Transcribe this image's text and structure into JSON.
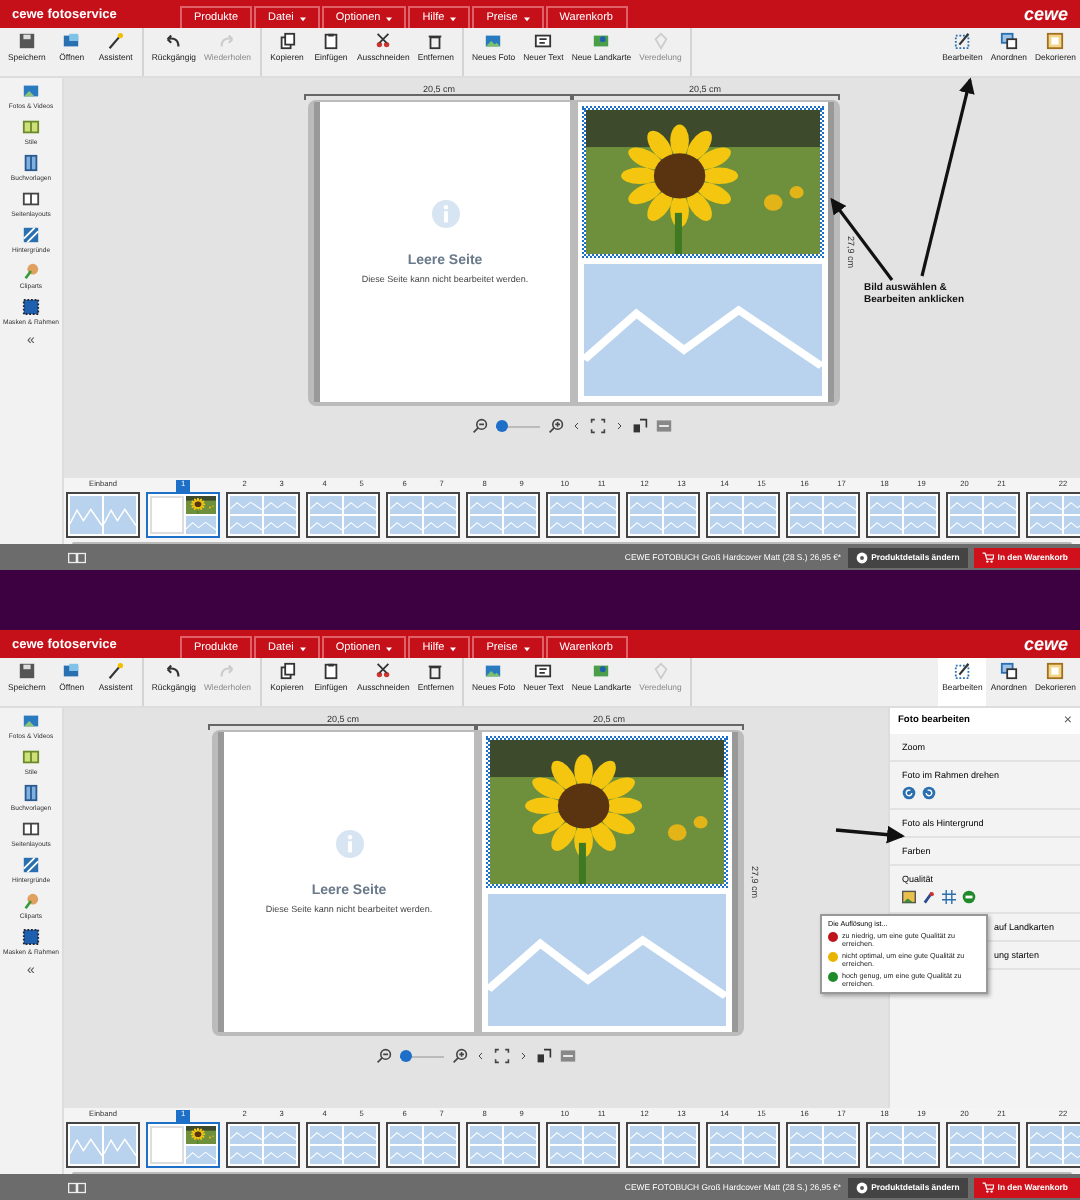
{
  "screens": [
    {
      "header": {
        "brand": "cewe fotoservice",
        "logo": "cewe",
        "menus": [
          {
            "label": "Produkte",
            "has_menu": false
          },
          {
            "label": "Datei",
            "has_menu": true
          },
          {
            "label": "Optionen",
            "has_menu": true
          },
          {
            "label": "Hilfe",
            "has_menu": true
          },
          {
            "label": "Preise",
            "has_menu": true
          },
          {
            "label": "Warenkorb",
            "has_menu": false
          }
        ]
      },
      "toolbar": {
        "groups": [
          [
            {
              "label": "Speichern",
              "disabled": false
            },
            {
              "label": "Öffnen",
              "disabled": false
            },
            {
              "label": "Assistent",
              "disabled": false
            }
          ],
          [
            {
              "label": "Rückgängig",
              "disabled": false
            },
            {
              "label": "Wiederholen",
              "disabled": true
            }
          ],
          [
            {
              "label": "Kopieren",
              "disabled": false
            },
            {
              "label": "Einfügen",
              "disabled": false
            },
            {
              "label": "Ausschneiden",
              "disabled": false
            },
            {
              "label": "Entfernen",
              "disabled": false
            }
          ],
          [
            {
              "label": "Neues Foto",
              "disabled": false
            },
            {
              "label": "Neuer Text",
              "disabled": false
            },
            {
              "label": "Neue Landkarte",
              "disabled": false
            },
            {
              "label": "Veredelung",
              "disabled": true
            }
          ]
        ],
        "right": [
          {
            "label": "Bearbeiten",
            "selected": false
          },
          {
            "label": "Anordnen",
            "selected": false
          },
          {
            "label": "Dekorieren",
            "selected": false
          }
        ]
      },
      "sidebar": {
        "items": [
          "Fotos & Videos",
          "Stile",
          "Buchvorlagen",
          "Seitenlayouts",
          "Hintergründe",
          "Cliparts",
          "Masken & Rahmen"
        ],
        "collapse": "«"
      },
      "spread": {
        "width_labels": [
          "20,5 cm",
          "20,5 cm"
        ],
        "height_label": "27,9 cm",
        "blank_title": "Leere Seite",
        "blank_text": "Diese Seite kann nicht bearbeitet werden.",
        "photo_selected": true
      },
      "zoom": {
        "level": 0.12
      },
      "filmstrip": [
        {
          "labels": [
            "Einband"
          ],
          "selected": false,
          "kind": "cover"
        },
        {
          "labels": [
            "1"
          ],
          "selected": true,
          "kind": "first"
        },
        {
          "labels": [
            "2",
            "3"
          ],
          "selected": false,
          "kind": "layout"
        },
        {
          "labels": [
            "4",
            "5"
          ],
          "selected": false,
          "kind": "layout"
        },
        {
          "labels": [
            "6",
            "7"
          ],
          "selected": false,
          "kind": "layout"
        },
        {
          "labels": [
            "8",
            "9"
          ],
          "selected": false,
          "kind": "layout"
        },
        {
          "labels": [
            "10",
            "11"
          ],
          "selected": false,
          "kind": "layout"
        },
        {
          "labels": [
            "12",
            "13"
          ],
          "selected": false,
          "kind": "layout"
        },
        {
          "labels": [
            "14",
            "15"
          ],
          "selected": false,
          "kind": "layout"
        },
        {
          "labels": [
            "16",
            "17"
          ],
          "selected": false,
          "kind": "layout"
        },
        {
          "labels": [
            "18",
            "19"
          ],
          "selected": false,
          "kind": "layout"
        },
        {
          "labels": [
            "20",
            "21"
          ],
          "selected": false,
          "kind": "layout"
        },
        {
          "labels": [
            "22"
          ],
          "selected": false,
          "kind": "layout"
        }
      ],
      "status": {
        "product": "CEWE FOTOBUCH Groß Hardcover Matt (28 S.) 26,95 €*",
        "details": "Produktdetails ändern",
        "cart": "In den Warenkorb"
      },
      "callout": {
        "kind": "text-arrows",
        "text": "Bild auswählen &\nBearbeiten anklicken"
      }
    },
    {
      "header": {
        "brand": "cewe fotoservice",
        "logo": "cewe",
        "menus": [
          {
            "label": "Produkte",
            "has_menu": false
          },
          {
            "label": "Datei",
            "has_menu": true
          },
          {
            "label": "Optionen",
            "has_menu": true
          },
          {
            "label": "Hilfe",
            "has_menu": true
          },
          {
            "label": "Preise",
            "has_menu": true
          },
          {
            "label": "Warenkorb",
            "has_menu": false
          }
        ]
      },
      "toolbar": {
        "groups": [
          [
            {
              "label": "Speichern",
              "disabled": false
            },
            {
              "label": "Öffnen",
              "disabled": false
            },
            {
              "label": "Assistent",
              "disabled": false
            }
          ],
          [
            {
              "label": "Rückgängig",
              "disabled": false
            },
            {
              "label": "Wiederholen",
              "disabled": true
            }
          ],
          [
            {
              "label": "Kopieren",
              "disabled": false
            },
            {
              "label": "Einfügen",
              "disabled": false
            },
            {
              "label": "Ausschneiden",
              "disabled": false
            },
            {
              "label": "Entfernen",
              "disabled": false
            }
          ],
          [
            {
              "label": "Neues Foto",
              "disabled": false
            },
            {
              "label": "Neuer Text",
              "disabled": false
            },
            {
              "label": "Neue Landkarte",
              "disabled": false
            },
            {
              "label": "Veredelung",
              "disabled": true
            }
          ]
        ],
        "right": [
          {
            "label": "Bearbeiten",
            "selected": true
          },
          {
            "label": "Anordnen",
            "selected": false
          },
          {
            "label": "Dekorieren",
            "selected": false
          }
        ]
      },
      "sidebar": {
        "items": [
          "Fotos & Videos",
          "Stile",
          "Buchvorlagen",
          "Seitenlayouts",
          "Hintergründe",
          "Cliparts",
          "Masken & Rahmen"
        ],
        "collapse": "«"
      },
      "spread": {
        "width_labels": [
          "20,5 cm",
          "20,5 cm"
        ],
        "height_label": "27,9 cm",
        "blank_title": "Leere Seite",
        "blank_text": "Diese Seite kann nicht bearbeitet werden.",
        "photo_selected": true
      },
      "zoom": {
        "level": 0.12
      },
      "filmstrip": [
        {
          "labels": [
            "Einband"
          ],
          "selected": false,
          "kind": "cover"
        },
        {
          "labels": [
            "1"
          ],
          "selected": true,
          "kind": "first"
        },
        {
          "labels": [
            "2",
            "3"
          ],
          "selected": false,
          "kind": "layout"
        },
        {
          "labels": [
            "4",
            "5"
          ],
          "selected": false,
          "kind": "layout"
        },
        {
          "labels": [
            "6",
            "7"
          ],
          "selected": false,
          "kind": "layout"
        },
        {
          "labels": [
            "8",
            "9"
          ],
          "selected": false,
          "kind": "layout"
        },
        {
          "labels": [
            "10",
            "11"
          ],
          "selected": false,
          "kind": "layout"
        },
        {
          "labels": [
            "12",
            "13"
          ],
          "selected": false,
          "kind": "layout"
        },
        {
          "labels": [
            "14",
            "15"
          ],
          "selected": false,
          "kind": "layout"
        },
        {
          "labels": [
            "16",
            "17"
          ],
          "selected": false,
          "kind": "layout"
        },
        {
          "labels": [
            "18",
            "19"
          ],
          "selected": false,
          "kind": "layout"
        },
        {
          "labels": [
            "20",
            "21"
          ],
          "selected": false,
          "kind": "layout"
        },
        {
          "labels": [
            "22"
          ],
          "selected": false,
          "kind": "layout"
        }
      ],
      "status": {
        "product": "CEWE FOTOBUCH Groß Hardcover Matt (28 S.) 26,95 €*",
        "details": "Produktdetails ändern",
        "cart": "In den Warenkorb"
      },
      "callout": {
        "kind": "arrow"
      },
      "edit_panel": {
        "title": "Foto bearbeiten",
        "close": "×",
        "sections": [
          {
            "label": "Zoom",
            "kind": "plain"
          },
          {
            "label": "Foto im Rahmen drehen",
            "kind": "rotate"
          },
          {
            "label": "Foto als Hintergrund",
            "kind": "plain"
          },
          {
            "label": "Farben",
            "kind": "plain"
          },
          {
            "label": "Qualität",
            "kind": "quality"
          },
          {
            "label": "auf Landkarten",
            "kind": "covered"
          },
          {
            "label": "ung starten",
            "kind": "covered"
          }
        ]
      },
      "tooltip": {
        "title": "Die Auflösung ist...",
        "rows": [
          {
            "color": "#c0141c",
            "text": "zu niedrig, um eine gute Qualität zu erreichen."
          },
          {
            "color": "#e8b400",
            "text": "nicht optimal, um eine gute Qualität zu erreichen."
          },
          {
            "color": "#1e8a2a",
            "text": "hoch genug, um eine gute Qualität zu erreichen."
          }
        ]
      }
    }
  ]
}
